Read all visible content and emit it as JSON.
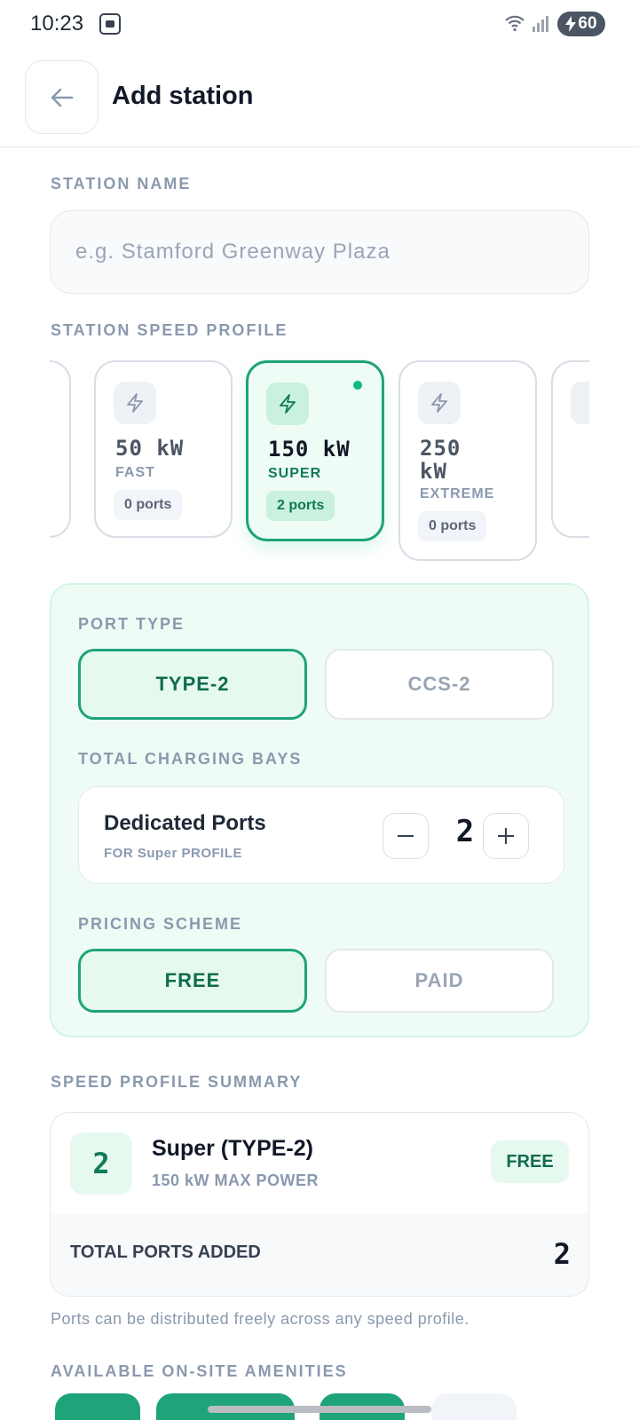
{
  "status_bar": {
    "time": "10:23",
    "battery": "60"
  },
  "header": {
    "title": "Add station"
  },
  "station_name": {
    "label": "STATION NAME",
    "placeholder": "e.g. Stamford Greenway Plaza",
    "value": ""
  },
  "speed_profile": {
    "label": "STATION SPEED PROFILE",
    "cards": [
      {
        "power": "50 kW",
        "tier": "FAST",
        "ports": "0 ports",
        "selected": false
      },
      {
        "power": "150 kW",
        "tier": "SUPER",
        "ports": "2 ports",
        "selected": true
      },
      {
        "power": "250 kW",
        "tier": "EXTREME",
        "ports": "0 ports",
        "selected": false
      }
    ]
  },
  "port_type": {
    "label": "PORT TYPE",
    "options": [
      "TYPE-2",
      "CCS-2"
    ],
    "selected": "TYPE-2"
  },
  "charging_bays": {
    "label": "TOTAL CHARGING BAYS",
    "title": "Dedicated Ports",
    "subtitle": "FOR Super PROFILE",
    "value": "2"
  },
  "pricing": {
    "label": "PRICING SCHEME",
    "options": [
      "FREE",
      "PAID"
    ],
    "selected": "FREE"
  },
  "summary": {
    "label": "SPEED PROFILE SUMMARY",
    "count": "2",
    "title": "Super (TYPE-2)",
    "subtitle": "150 kW MAX POWER",
    "badge": "FREE",
    "total_label": "TOTAL PORTS ADDED",
    "total_value": "2"
  },
  "note": "Ports can be distributed freely across any speed profile.",
  "amenities": {
    "label": "AVAILABLE ON-SITE AMENITIES"
  },
  "colors": {
    "accent": "#1fa37a",
    "accent_dark": "#0f6c4e",
    "panel_bg": "#effcf5",
    "muted": "#8a99ae"
  }
}
